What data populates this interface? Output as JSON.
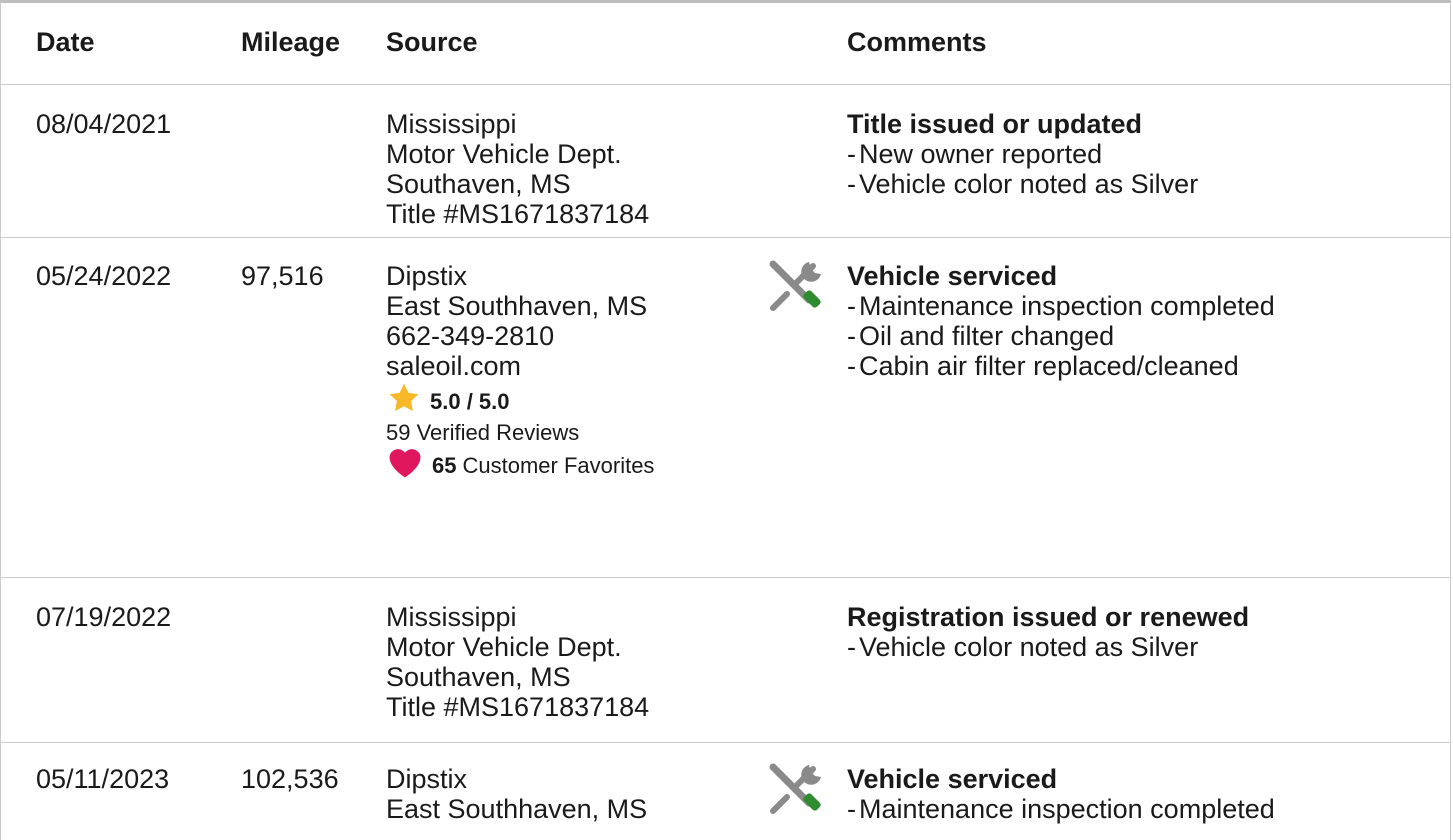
{
  "header": {
    "date": "Date",
    "mileage": "Mileage",
    "source": "Source",
    "comments": "Comments"
  },
  "rows": [
    {
      "date": "08/04/2021",
      "mileage": "",
      "source": [
        "Mississippi",
        "Motor Vehicle Dept.",
        "Southaven, MS",
        "Title #MS1671837184"
      ],
      "icon": "",
      "comment_title": "Title issued or updated",
      "comment_items": [
        "New owner reported",
        "Vehicle color noted as Silver"
      ]
    },
    {
      "date": "05/24/2022",
      "mileage": "97,516",
      "source": [
        "Dipstix",
        "East Southhaven, MS",
        "662-349-2810",
        "saleoil.com"
      ],
      "rating": "5.0 / 5.0",
      "reviews": "59 Verified Reviews",
      "favorites_count": "65",
      "favorites_label": "Customer Favorites",
      "icon": "service-tools-icon",
      "comment_title": "Vehicle serviced",
      "comment_items": [
        "Maintenance inspection completed",
        "Oil and filter changed",
        "Cabin air filter replaced/cleaned"
      ]
    },
    {
      "date": "07/19/2022",
      "mileage": "",
      "source": [
        "Mississippi",
        "Motor Vehicle Dept.",
        "Southaven, MS",
        "Title #MS1671837184"
      ],
      "icon": "",
      "comment_title": "Registration issued or renewed",
      "comment_items": [
        "Vehicle color noted as Silver"
      ]
    },
    {
      "date": "05/11/2023",
      "mileage": "102,536",
      "source": [
        "Dipstix",
        "East Southhaven, MS"
      ],
      "icon": "service-tools-icon",
      "comment_title": "Vehicle serviced",
      "comment_items": [
        "Maintenance inspection completed"
      ]
    }
  ],
  "bullet_dash": "-",
  "colors": {
    "star": "#f7b928",
    "heart": "#e0175f",
    "wrench": "#8a8a8a",
    "screwdriver": "#2e8b2e",
    "border": "#c9c9c9"
  }
}
